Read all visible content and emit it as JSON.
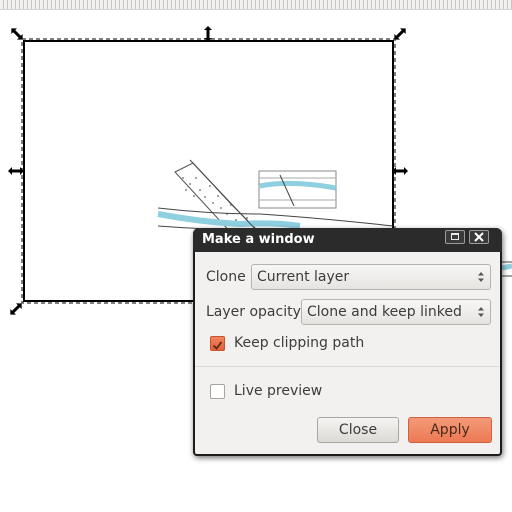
{
  "dialog": {
    "title": "Make a window",
    "clone_label": "Clone",
    "clone_value": "Current layer",
    "layer_opacity_label": "Layer opacity",
    "layer_opacity_value": "Clone and keep linked",
    "keep_clipping_label": "Keep clipping path",
    "keep_clipping_checked": true,
    "live_preview_label": "Live preview",
    "live_preview_checked": false,
    "close_label": "Close",
    "apply_label": "Apply"
  },
  "icons": {
    "maximize": "maximize-icon",
    "close": "close-icon",
    "resize_handle": "double-arrow-icon"
  },
  "colors": {
    "accent": "#ec7a54",
    "titlebar": "#2b2b2b",
    "river": "#8ecfe0"
  }
}
